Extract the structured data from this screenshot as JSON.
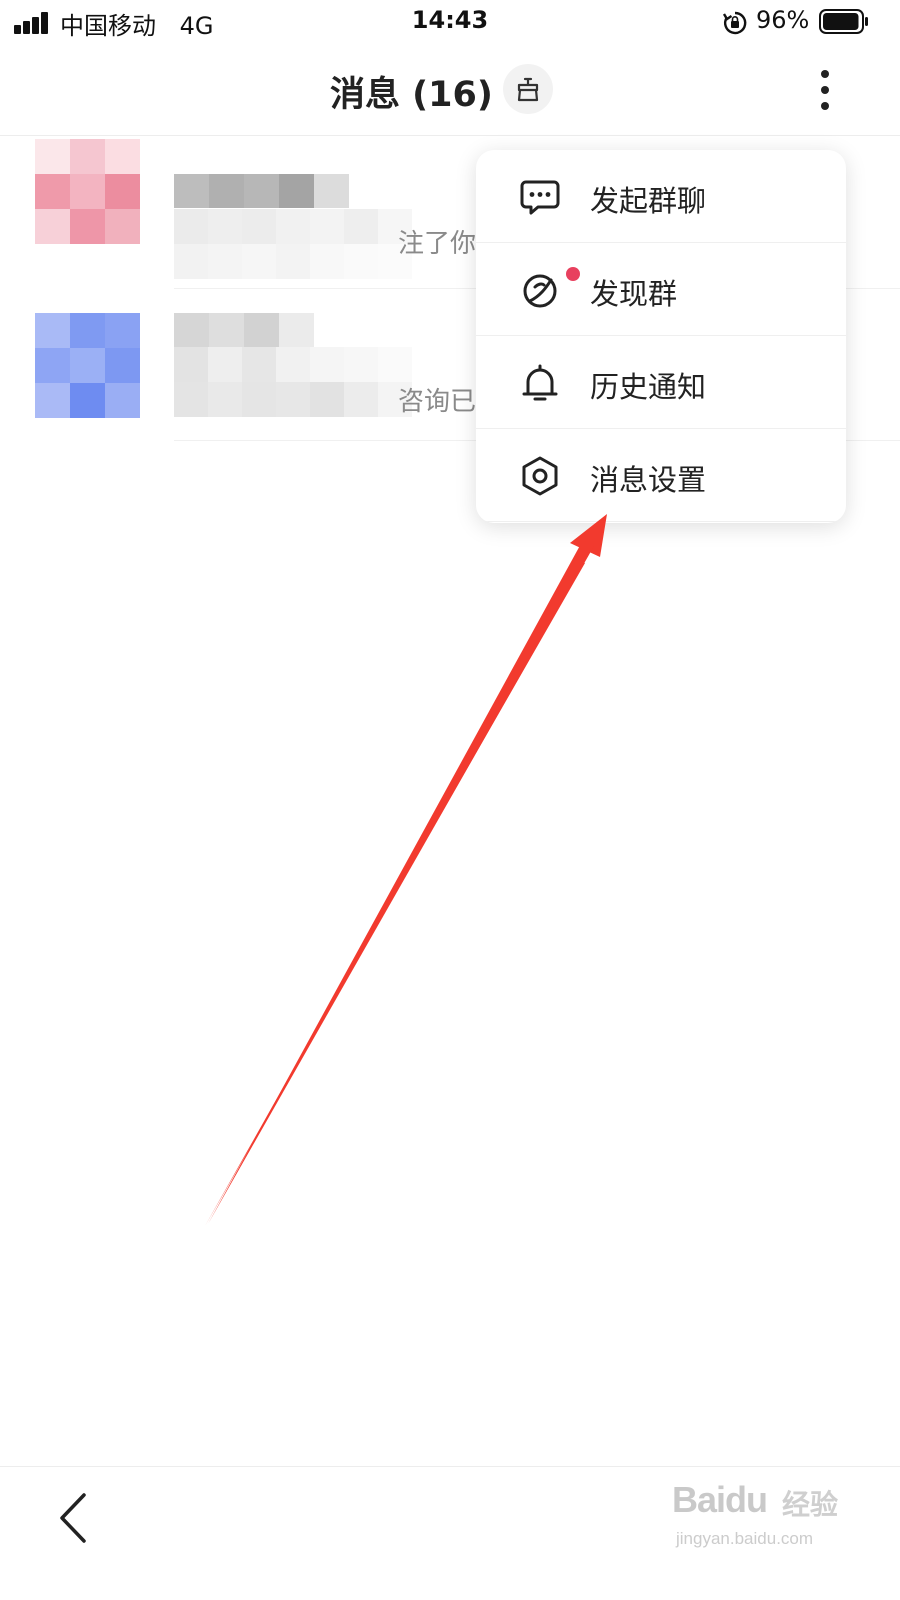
{
  "status_bar": {
    "carrier": "中国移动",
    "network": "4G",
    "time": "14:43",
    "battery_percent": "96%",
    "battery_level": 0.96
  },
  "header": {
    "title": "消息 (16)",
    "clean_icon": "broom-icon",
    "more_icon": "more-vertical-icon"
  },
  "conversations": [
    {
      "preview_fragment": "注了你",
      "avatar_tone": "pink"
    },
    {
      "preview_fragment": "咨询已",
      "avatar_tone": "blue"
    }
  ],
  "popup_menu": {
    "items": [
      {
        "label": "发起群聊",
        "icon": "chat-bubble-icon"
      },
      {
        "label": "发现群",
        "icon": "planet-icon",
        "has_badge": true
      },
      {
        "label": "历史通知",
        "icon": "bell-icon"
      },
      {
        "label": "消息设置",
        "icon": "hexagon-settings-icon"
      }
    ]
  },
  "annotation": {
    "color": "#f23a2e"
  },
  "footer": {
    "back_icon": "chevron-left-icon"
  },
  "watermark": {
    "brand": "Baidu",
    "product": "经验",
    "url": "jingyan.baidu.com"
  },
  "colors": {
    "badge": "#e8405e",
    "divider": "#efefef",
    "text_primary": "#222222",
    "text_secondary": "#8a8a8a"
  }
}
